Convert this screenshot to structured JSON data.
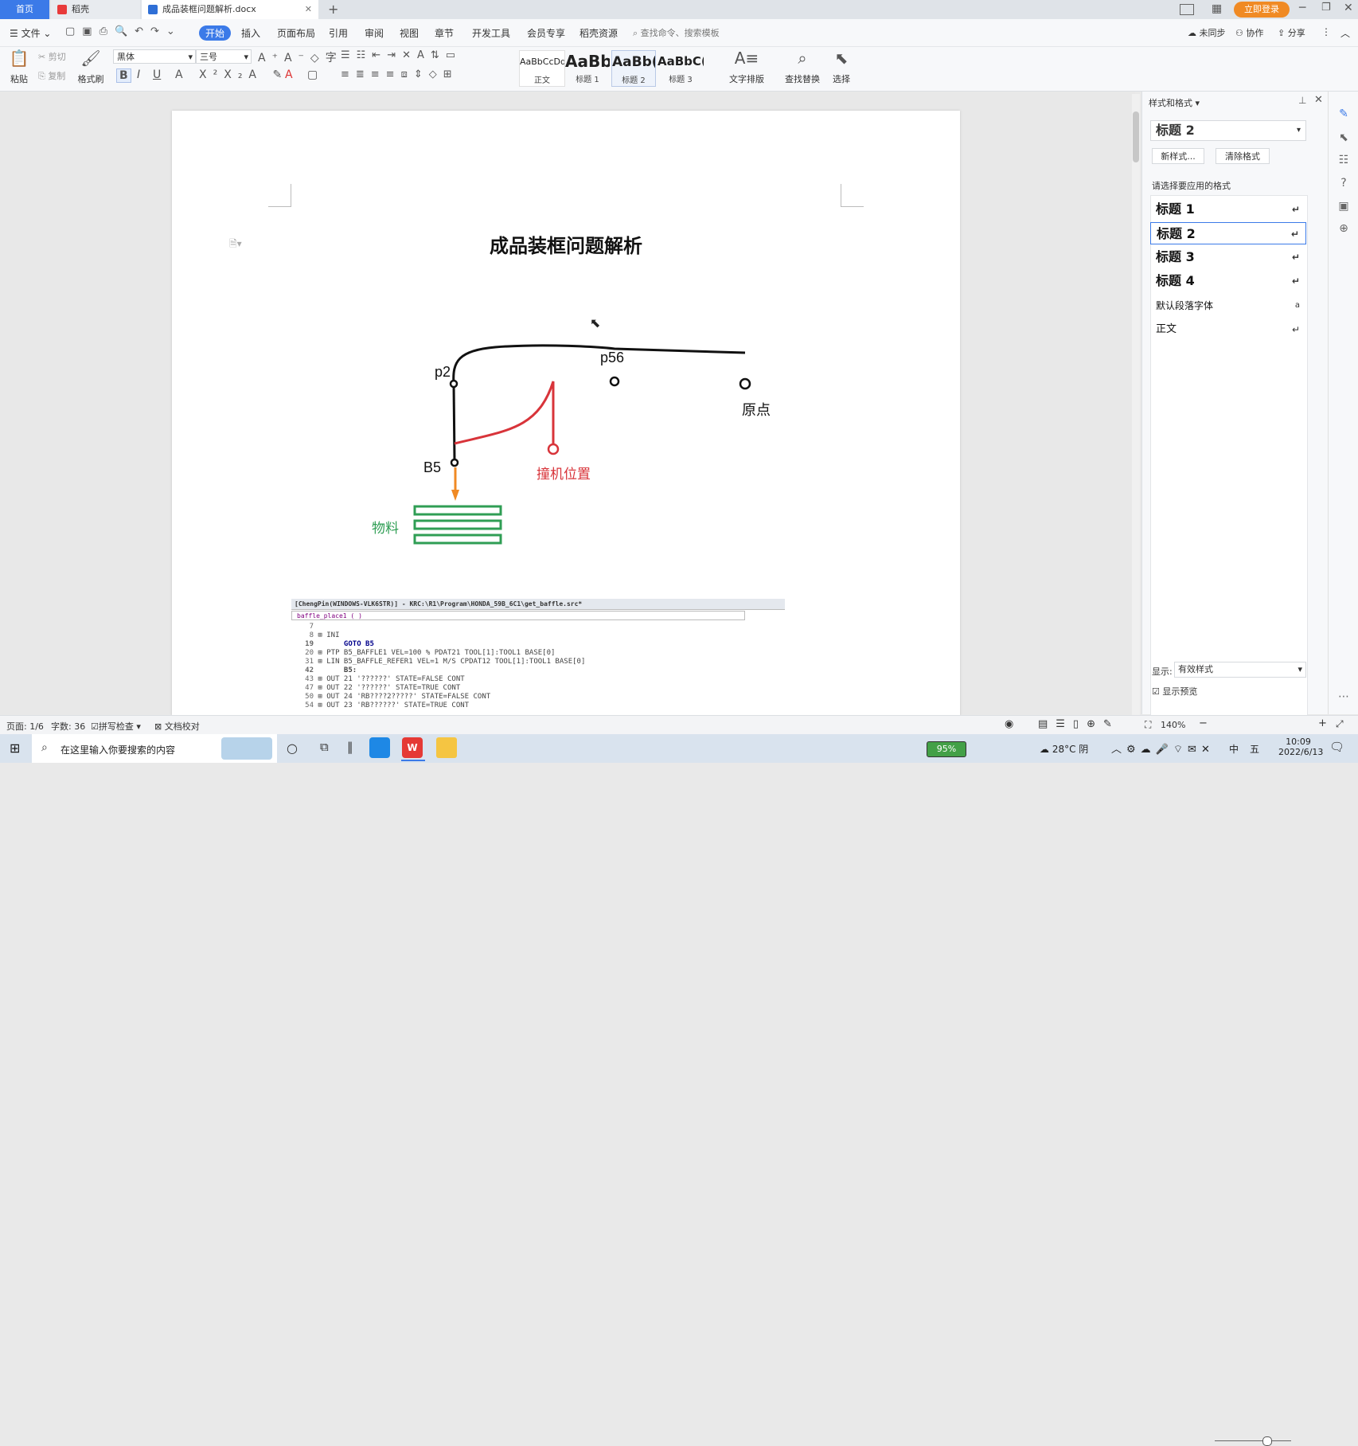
{
  "tabs": {
    "home": "首页",
    "daoke": "稻壳",
    "document": "成品装框问题解析.docx"
  },
  "window": {
    "login_label": "立即登录"
  },
  "menu": {
    "file": "文件",
    "items": [
      "开始",
      "插入",
      "页面布局",
      "引用",
      "审阅",
      "视图",
      "章节",
      "开发工具",
      "会员专享",
      "稻壳资源"
    ],
    "search_placeholder": "查找命令、搜索模板",
    "sync": "未同步",
    "collab": "协作",
    "share": "分享"
  },
  "ribbon": {
    "paste": "粘贴",
    "cut": "剪切",
    "copy": "复制",
    "format_painter": "格式刷",
    "font_name": "黑体",
    "font_size": "三号",
    "styles": [
      {
        "preview": "AaBbCcDd",
        "label": "正文"
      },
      {
        "preview": "AaBb",
        "label": "标题 1"
      },
      {
        "preview": "AaBb(",
        "label": "标题 2"
      },
      {
        "preview": "AaBbC(",
        "label": "标题 3"
      }
    ],
    "text_layout": "文字排版",
    "find_replace": "查找替换",
    "select": "选择"
  },
  "document": {
    "title": "成品装框问题解析",
    "diagram": {
      "p2": "p2",
      "p56": "p56",
      "origin": "原点",
      "b5": "B5",
      "collision": "撞机位置",
      "material": "物料"
    },
    "code": {
      "window_title": "[ChengPin(WINDOWS-VLK6STR)] - KRC:\\R1\\Program\\HONDA_59B_6C1\\get_baffle.src*",
      "function": "baffle_place1 ( )",
      "lines": [
        {
          "n": "7",
          "t": ""
        },
        {
          "n": "8",
          "t": "⊞ INI"
        },
        {
          "n": "19",
          "t": "      GOTO B5"
        },
        {
          "n": "20",
          "t": "⊞ PTP B5_BAFFLE1 VEL=100 % PDAT21 TOOL[1]:TOOL1 BASE[0]"
        },
        {
          "n": "31",
          "t": "⊞ LIN B5_BAFFLE_REFER1 VEL=1 M/S CPDAT12 TOOL[1]:TOOL1 BASE[0]"
        },
        {
          "n": "42",
          "t": "      B5:"
        },
        {
          "n": "43",
          "t": "⊞ OUT 21 '??????' STATE=FALSE CONT"
        },
        {
          "n": "47",
          "t": "⊞ OUT 22 '??????' STATE=TRUE CONT"
        },
        {
          "n": "50",
          "t": "⊞ OUT 24 'RB????2?????' STATE=FALSE CONT"
        },
        {
          "n": "54",
          "t": "⊞ OUT 23 'RB??????' STATE=TRUE CONT"
        }
      ]
    }
  },
  "panel": {
    "title": "样式和格式",
    "current_style": "标题 2",
    "new_style": "新样式...",
    "clear_format": "清除格式",
    "prompt": "请选择要应用的格式",
    "styles": [
      "标题 1",
      "标题 2",
      "标题 3",
      "标题 4",
      "默认段落字体",
      "正文"
    ],
    "show_label": "显示:",
    "show_value": "有效样式",
    "preview_label": "显示预览"
  },
  "status": {
    "page": "页面: 1/6",
    "words": "字数: 36",
    "spell": "拼写检查",
    "proof": "文档校对",
    "zoom": "140%"
  },
  "taskbar": {
    "search_placeholder": "在这里输入你要搜索的内容",
    "battery": "95%",
    "weather": "28°C 阴",
    "ime": "中",
    "day": "五",
    "time": "10:09",
    "date": "2022/6/13"
  },
  "colors": {
    "accent": "#3b7ae8",
    "collision_red": "#d8343a",
    "material_green": "#2f9e54",
    "arrow_orange": "#f08a24"
  }
}
